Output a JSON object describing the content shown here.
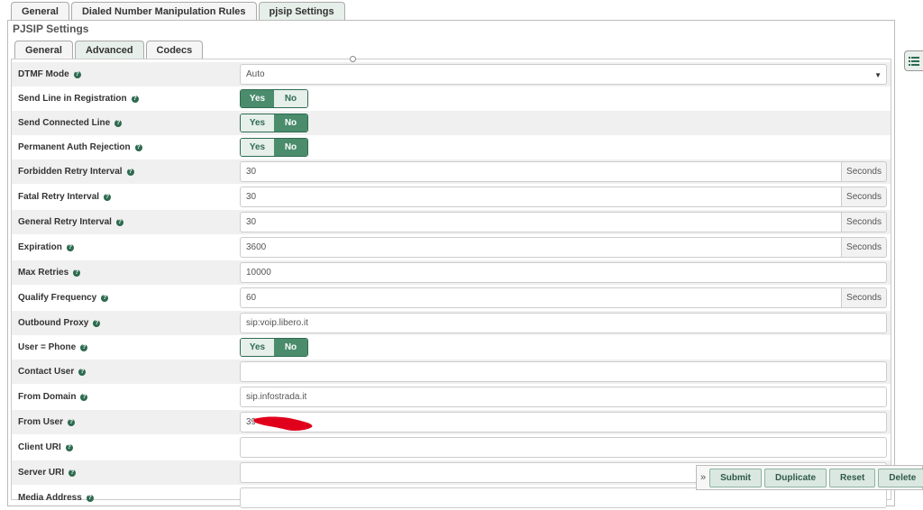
{
  "top_tabs": [
    {
      "label": "General"
    },
    {
      "label": "Dialed Number Manipulation Rules"
    },
    {
      "label": "pjsip Settings"
    }
  ],
  "section_title": "PJSIP Settings",
  "sub_tabs": [
    {
      "label": "General"
    },
    {
      "label": "Advanced"
    },
    {
      "label": "Codecs"
    }
  ],
  "fields": {
    "dtmf_mode": {
      "label": "DTMF Mode",
      "value": "Auto"
    },
    "send_line_in_registration": {
      "label": "Send Line in Registration",
      "yes": "Yes",
      "no": "No",
      "selected": "Yes"
    },
    "send_connected_line": {
      "label": "Send Connected Line",
      "yes": "Yes",
      "no": "No",
      "selected": "No"
    },
    "permanent_auth_rejection": {
      "label": "Permanent Auth Rejection",
      "yes": "Yes",
      "no": "No",
      "selected": "No"
    },
    "forbidden_retry_interval": {
      "label": "Forbidden Retry Interval",
      "value": "30",
      "unit": "Seconds"
    },
    "fatal_retry_interval": {
      "label": "Fatal Retry Interval",
      "value": "30",
      "unit": "Seconds"
    },
    "general_retry_interval": {
      "label": "General Retry Interval",
      "value": "30",
      "unit": "Seconds"
    },
    "expiration": {
      "label": "Expiration",
      "value": "3600",
      "unit": "Seconds"
    },
    "max_retries": {
      "label": "Max Retries",
      "value": "10000"
    },
    "qualify_frequency": {
      "label": "Qualify Frequency",
      "value": "60",
      "unit": "Seconds"
    },
    "outbound_proxy": {
      "label": "Outbound Proxy",
      "value": "sip:voip.libero.it"
    },
    "user_phone": {
      "label": "User = Phone",
      "yes": "Yes",
      "no": "No",
      "selected": "No"
    },
    "contact_user": {
      "label": "Contact User",
      "value": ""
    },
    "from_domain": {
      "label": "From Domain",
      "value": "sip.infostrada.it"
    },
    "from_user": {
      "label": "From User",
      "value": "39"
    },
    "client_uri": {
      "label": "Client URI",
      "value": ""
    },
    "server_uri": {
      "label": "Server URI",
      "value": ""
    },
    "media_address": {
      "label": "Media Address",
      "value": ""
    }
  },
  "help_glyph": "?",
  "actions": {
    "chevron": "»",
    "submit": "Submit",
    "duplicate": "Duplicate",
    "reset": "Reset",
    "delete": "Delete"
  },
  "colors": {
    "accent": "#4a8c6c",
    "accent_light": "#e6efe9",
    "redaction": "#e0001b"
  }
}
